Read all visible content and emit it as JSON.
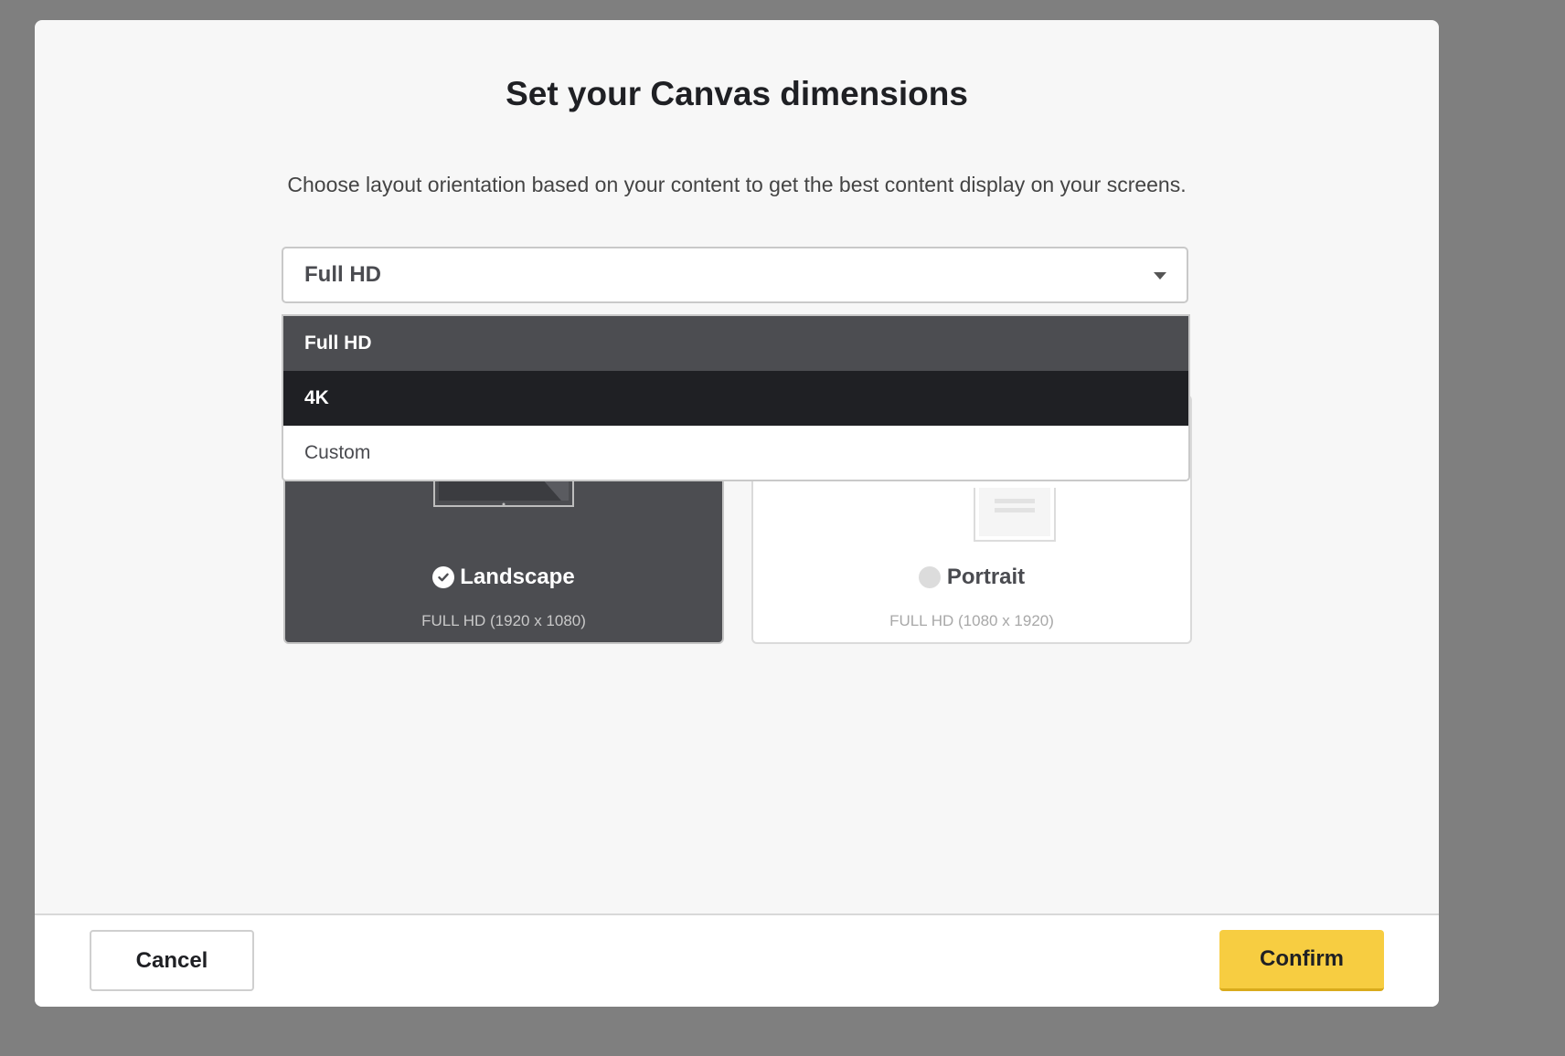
{
  "modal": {
    "title": "Set your Canvas dimensions",
    "subtitle": "Choose layout orientation based on your content to get the best content display on your screens."
  },
  "resolution_select": {
    "value": "Full HD",
    "options": [
      {
        "label": "Full HD",
        "state": "selected"
      },
      {
        "label": "4K",
        "state": "hover"
      },
      {
        "label": "Custom",
        "state": "default"
      }
    ]
  },
  "orientation": {
    "landscape": {
      "label": "Landscape",
      "detail": "FULL HD (1920 x 1080)",
      "checked": true
    },
    "portrait": {
      "label": "Portrait",
      "detail": "FULL HD (1080 x 1920)",
      "checked": false
    }
  },
  "footer": {
    "cancel_label": "Cancel",
    "confirm_label": "Confirm"
  },
  "colors": {
    "accent": "#f7cd41",
    "selected_card": "#4c4d51",
    "hover_option": "#1f2024",
    "overlay": "#7f7f7f"
  }
}
